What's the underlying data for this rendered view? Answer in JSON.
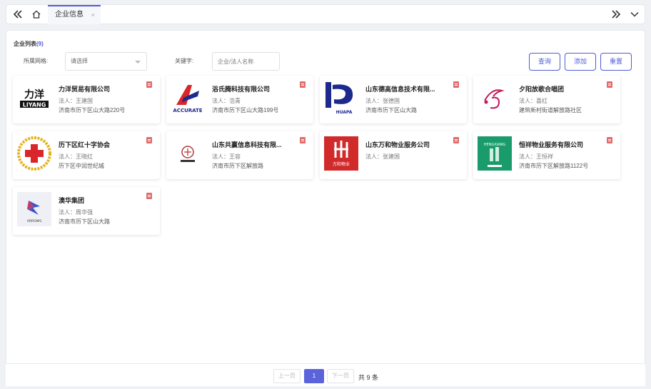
{
  "tabs": {
    "active_label": "企业信息",
    "close": "×"
  },
  "list": {
    "title": "企业列表",
    "count": "(9)"
  },
  "filters": {
    "grid_label": "所属网格:",
    "grid_value": "请选择",
    "keyword_label": "关键字:",
    "keyword_placeholder": "企业/法人名称"
  },
  "buttons": {
    "query": "查询",
    "add": "添加",
    "reset": "重置"
  },
  "companies": [
    {
      "name": "力洋贸易有限公司",
      "legal": "法人：王建国",
      "address": "济南市历下区山大路220号",
      "logo": "LIYANG"
    },
    {
      "name": "浴氏腾科技有限公司",
      "legal": "法人：浩青",
      "address": "济南市历下区山大路199号",
      "logo": "ACCURATE"
    },
    {
      "name": "山东德高信息技术有限...",
      "legal": "法人：张德国",
      "address": "济南市历下区山大路",
      "logo": "HUAPA"
    },
    {
      "name": "夕阳放歌合唱团",
      "legal": "法人：喜红",
      "address": "建筑新村街道解放路社区",
      "logo": ""
    },
    {
      "name": "历下区红十字协会",
      "legal": "法人：王晓红",
      "address": "历下区中润世纪城",
      "logo": ""
    },
    {
      "name": "山东共赢信息科技有限...",
      "legal": "法人：王容",
      "address": "济南市历下区解放路",
      "logo": ""
    },
    {
      "name": "山东万和物业服务公司",
      "legal": "法人：张建国",
      "address": "",
      "logo": "万和物业"
    },
    {
      "name": "恒祥物业服务有限公司",
      "legal": "法人：王恒祥",
      "address": "济南市历下区解放路1122号",
      "logo": "HENGXIANG"
    },
    {
      "name": "澳华集团",
      "legal": "法人：周华强",
      "address": "济南市历下区山大路",
      "logo": "ARROWS"
    }
  ],
  "pager": {
    "prev": "上一页",
    "current": "1",
    "next": "下一页",
    "total": "共 9 条"
  },
  "colors": {
    "accent": "#4f5bd5",
    "delete": "#e06c6c"
  }
}
